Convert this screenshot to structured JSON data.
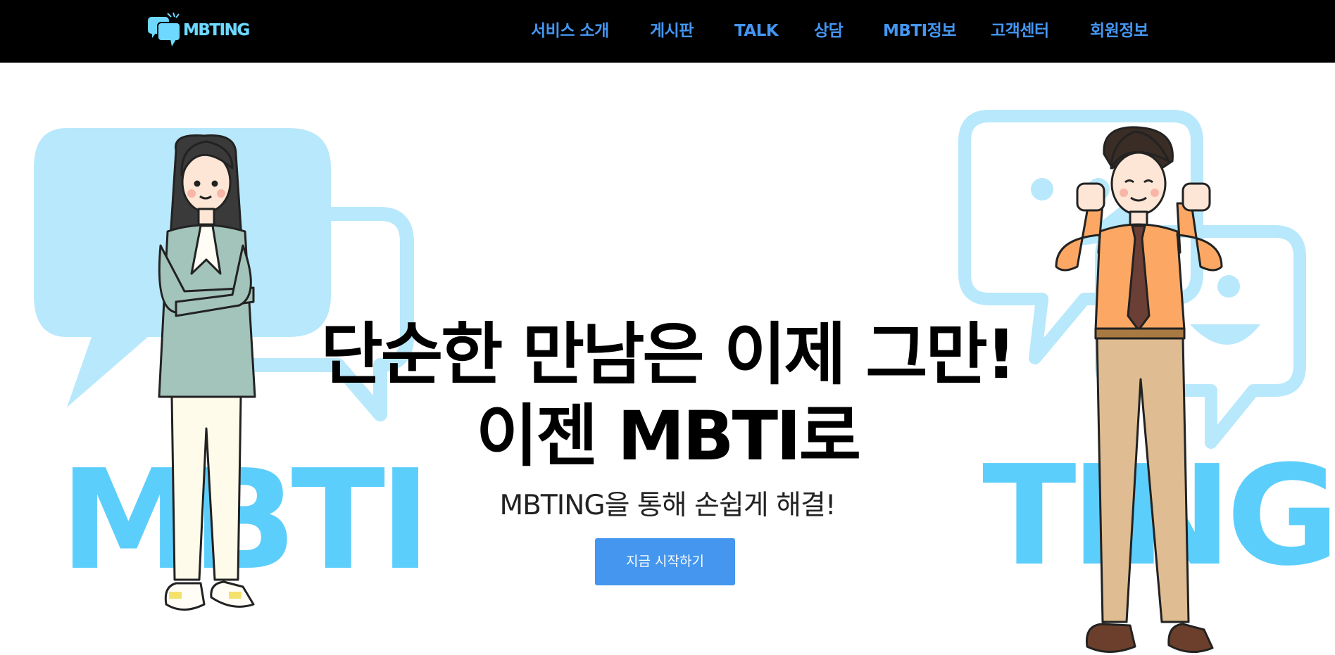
{
  "header": {
    "logo_text": "MBTING",
    "nav": [
      {
        "label": "서비스 소개"
      },
      {
        "label": "게시판"
      },
      {
        "label": "TALK"
      },
      {
        "label": "상담"
      },
      {
        "label": "MBTI정보"
      },
      {
        "label": "고객센터"
      },
      {
        "label": "회원정보"
      }
    ]
  },
  "hero": {
    "headline_line1": "단순한 만남은 이제 그만!",
    "headline_line2": "이젠 MBTI로",
    "subline": "MBTING을 통해 손쉽게 해결!",
    "cta_label": "지금 시작하기",
    "left_word": "MBTI",
    "right_word": "TING"
  },
  "colors": {
    "nav_text": "#4496f2",
    "header_bg": "#000000",
    "cta_bg": "#4496ee",
    "bubble_light": "#b8e8fb",
    "word_blue": "#5ccefc"
  }
}
